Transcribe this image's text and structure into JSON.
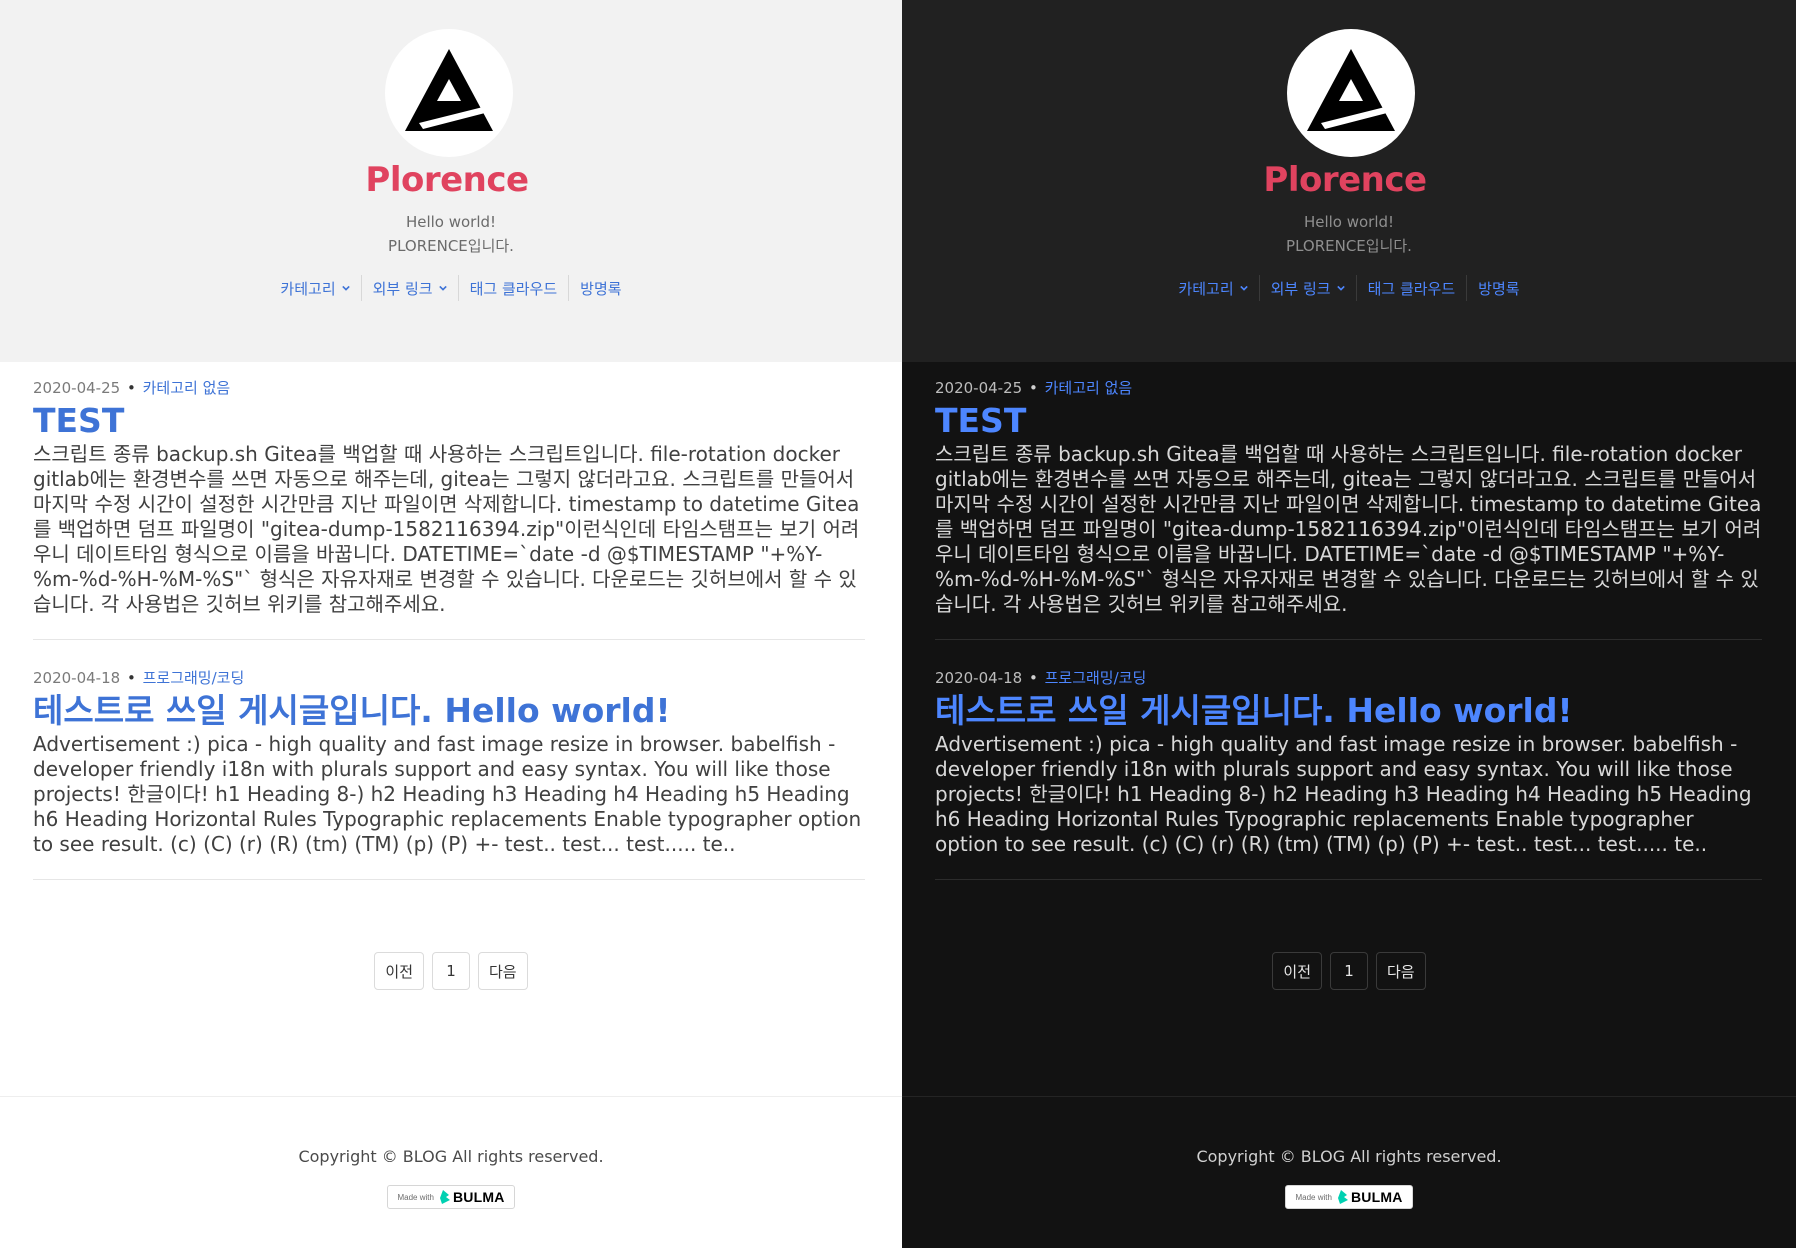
{
  "blog": {
    "title": "Plorence",
    "description_line1": "Hello world!",
    "description_line2": "PLORENCE입니다."
  },
  "nav": {
    "items": [
      {
        "label": "카테고리",
        "dropdown": true
      },
      {
        "label": "외부 링크",
        "dropdown": true
      },
      {
        "label": "태그 클라우드",
        "dropdown": false
      },
      {
        "label": "방명록",
        "dropdown": false
      }
    ]
  },
  "posts": [
    {
      "date": "2020-04-25",
      "separator": "•",
      "category": "카테고리 없음",
      "title": "TEST",
      "excerpt": "스크립트 종류 backup.sh Gitea를 백업할 때 사용하는 스크립트입니다. file-rotation docker gitlab에는 환경변수를 쓰면 자동으로 해주는데, gitea는 그렇지 않더라고요. 스크립트를 만들어서 마지막 수정 시간이 설정한 시간만큼 지난 파일이면 삭제합니다. timestamp to datetime Gitea를 백업하면 덤프 파일명이 \"gitea-dump-1582116394.zip\"이런식인데 타임스탬프는 보기 어려우니 데이트타임 형식으로 이름을 바꿉니다. DATETIME=`date -d @$TIMESTAMP \"+%Y-%m-%d-%H-%M-%S\"` 형식은 자유자재로 변경할 수 있습니다. 다운로드는 깃허브에서 할 수 있습니다. 각 사용법은 깃허브 위키를 참고해주세요."
    },
    {
      "date": "2020-04-18",
      "separator": "•",
      "category": "프로그래밍/코딩",
      "title": "테스트로 쓰일 게시글입니다. Hello world!",
      "excerpt": "Advertisement :) pica - high quality and fast image resize in browser. babelfish - developer friendly i18n with plurals support and easy syntax. You will like those projects! 한글이다! h1 Heading 8-) h2 Heading h3 Heading h4 Heading h5 Heading h6 Heading Horizontal Rules Typographic replacements Enable typographer option to see result. (c) (C) (r) (R) (tm) (TM) (p) (P) +- test.. test... test..... te.."
    }
  ],
  "pagination": {
    "prev_label": "이전",
    "current_page": "1",
    "next_label": "다음"
  },
  "footer": {
    "copyright": "Copyright © BLOG All rights reserved.",
    "made_with": "Made with",
    "framework": "BULMA"
  },
  "colors": {
    "accent_title": "#e0435f",
    "link_light": "#3e73d6",
    "link_dark": "#4d86ff",
    "hero_light": "#f2f2f2",
    "hero_dark": "#212121",
    "body_dark": "#121212",
    "bulma_teal": "#00d1b2"
  },
  "icons": {
    "avatar": "triangle-a-logo",
    "dropdown": "chevron-down-icon",
    "bulma": "bulma-logo"
  }
}
